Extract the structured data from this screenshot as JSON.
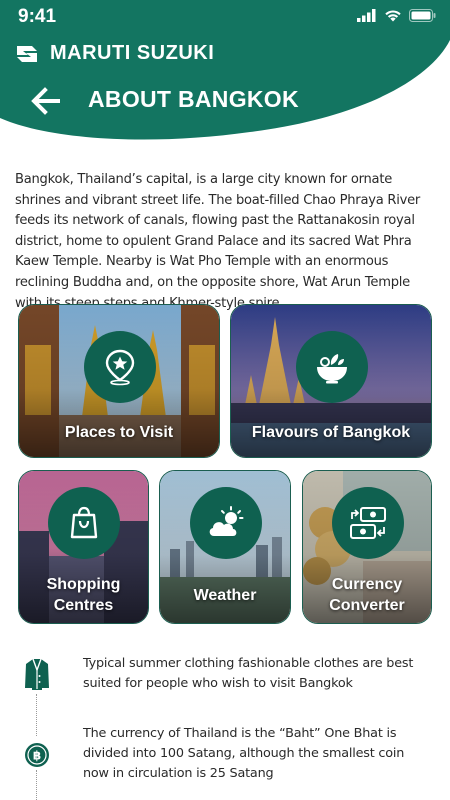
{
  "status": {
    "time": "9:41"
  },
  "brand": {
    "name": "MARUTI SUZUKI"
  },
  "header": {
    "title": "ABOUT BANGKOK"
  },
  "intro": "Bangkok, Thailand’s capital, is a large city known for ornate shrines and vibrant street life. The boat-filled Chao Phraya River feeds its network of canals, flowing past the Rattanakosin royal district, home to opulent Grand Palace and its sacred Wat Phra Kaew Temple. Nearby is Wat Pho Temple with an enormous reclining Buddha and, on the opposite shore, Wat Arun Temple with its steep steps and Khmer-style spire.",
  "cards": [
    {
      "label": "Places to Visit",
      "icon": "map-pin-star-icon"
    },
    {
      "label": "Flavours of Bangkok",
      "icon": "salad-bowl-icon"
    },
    {
      "label_line1": "Shopping",
      "label_line2": "Centres",
      "icon": "shopping-bag-icon"
    },
    {
      "label": "Weather",
      "icon": "sun-cloud-icon"
    },
    {
      "label_line1": "Currency",
      "label_line2": "Converter",
      "icon": "currency-exchange-icon"
    }
  ],
  "info": [
    {
      "text": "Typical summer clothing fashionable clothes are best suited for people who wish to visit Bangkok",
      "icon": "jacket-icon"
    },
    {
      "text": "The currency of Thailand is the “Baht” One Bhat is divided into 100 Satang, although the smallest coin now in circulation is 25 Satang",
      "icon": "baht-coin-icon"
    }
  ],
  "colors": {
    "primary": "#0f6150",
    "header": "#157a63",
    "text": "#2a2a2a"
  }
}
